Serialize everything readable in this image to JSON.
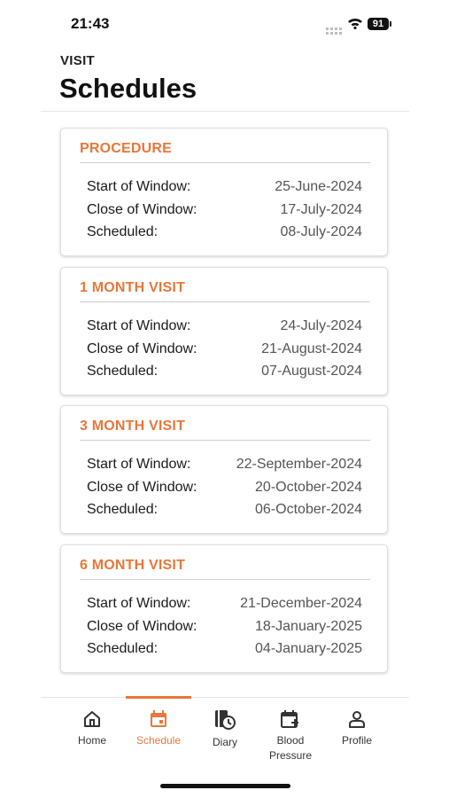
{
  "status_bar": {
    "time": "21:43",
    "battery": "91"
  },
  "header": {
    "subtitle": "VISIT",
    "title": "Schedules"
  },
  "cards": [
    {
      "title": "PROCEDURE",
      "rows": [
        {
          "label": "Start of Window:",
          "value": "25-June-2024"
        },
        {
          "label": "Close of Window:",
          "value": "17-July-2024"
        },
        {
          "label": "Scheduled:",
          "value": "08-July-2024"
        }
      ]
    },
    {
      "title": "1 MONTH VISIT",
      "rows": [
        {
          "label": "Start of Window:",
          "value": "24-July-2024"
        },
        {
          "label": "Close of Window:",
          "value": "21-August-2024"
        },
        {
          "label": "Scheduled:",
          "value": "07-August-2024"
        }
      ]
    },
    {
      "title": "3 MONTH VISIT",
      "rows": [
        {
          "label": "Start of Window:",
          "value": "22-September-2024"
        },
        {
          "label": "Close of Window:",
          "value": "20-October-2024"
        },
        {
          "label": "Scheduled:",
          "value": "06-October-2024"
        }
      ]
    },
    {
      "title": "6 MONTH VISIT",
      "rows": [
        {
          "label": "Start of Window:",
          "value": "21-December-2024"
        },
        {
          "label": "Close of Window:",
          "value": "18-January-2025"
        },
        {
          "label": "Scheduled:",
          "value": "04-January-2025"
        }
      ]
    }
  ],
  "tab_bar": {
    "items": [
      {
        "label": "Home",
        "icon": "home-icon"
      },
      {
        "label": "Schedule",
        "icon": "calendar-icon"
      },
      {
        "label": "Diary",
        "icon": "diary-clock-icon"
      },
      {
        "label": "Blood Pressure",
        "icon": "calendar-plus-icon"
      },
      {
        "label": "Profile",
        "icon": "person-icon"
      }
    ],
    "active": "Schedule"
  },
  "colors": {
    "accent": "#e8773a",
    "text": "#111111",
    "muted": "#555555"
  }
}
